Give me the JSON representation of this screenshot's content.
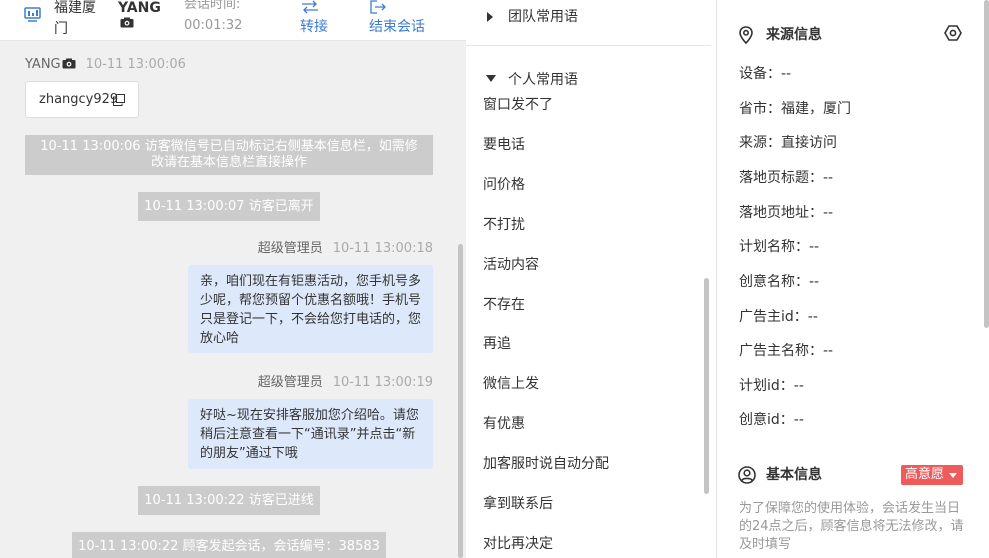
{
  "chat": {
    "header": {
      "location": "福建厦门",
      "visitor_name": "YANG",
      "time_label": "会话时间:",
      "time_value": "00:01:32",
      "transfer_label": "转接",
      "end_label": "结束会话"
    },
    "visitor_message": {
      "sender": "YANG",
      "timestamp": "10-11 13:00:06",
      "text": "zhangcy929"
    },
    "system_messages": [
      "10-11 13:00:06 访客微信号已自动标记右侧基本信息栏，如需修改请在基本信息栏直接操作",
      "10-11 13:00:07 访客已离开",
      "10-11 13:00:22 访客已进线",
      "10-11 13:00:22 顾客发起会话，会话编号：38583"
    ],
    "agent_messages": [
      {
        "sender": "超级管理员",
        "timestamp": "10-11 13:00:18",
        "text": "亲，咱们现在有钜惠活动，您手机号多少呢，帮您预留个优惠名额哦！手机号只是登记一下，不会给您打电话的，您放心哈"
      },
      {
        "sender": "超级管理员",
        "timestamp": "10-11 13:00:19",
        "text": "好哒~现在安排客服加您介绍哈。请您稍后注意查看一下“通讯录”并点击“新的朋友”通过下哦"
      }
    ]
  },
  "phrases": {
    "team_group": "团队常用语",
    "personal_group": "个人常用语",
    "items": [
      "窗口发不了",
      "要电话",
      "问价格",
      "不打扰",
      "活动内容",
      "不存在",
      "再追",
      "微信上发",
      "有优惠",
      "加客服时说自动分配",
      "拿到联系后",
      "对比再决定"
    ]
  },
  "info": {
    "source_title": "来源信息",
    "rows": [
      {
        "label": "设备：",
        "value": "--"
      },
      {
        "label": "省市：",
        "value": "福建，厦门"
      },
      {
        "label": "来源：",
        "value": "直接访问"
      },
      {
        "label": "落地页标题：",
        "value": "--"
      },
      {
        "label": "落地页地址：",
        "value": "--"
      },
      {
        "label": "计划名称：",
        "value": "--"
      },
      {
        "label": "创意名称：",
        "value": "--"
      },
      {
        "label": "广告主id：",
        "value": "--"
      },
      {
        "label": "广告主名称：",
        "value": "--"
      },
      {
        "label": "计划id：",
        "value": "--"
      },
      {
        "label": "创意id：",
        "value": "--"
      }
    ],
    "basic_title": "基本信息",
    "intent": "高意愿",
    "note": "为了保障您的使用体验，会话发生当日的24点之后，顾客信息将无法修改，请及时填写"
  },
  "colors": {
    "accent": "#3d7bd6",
    "agent_bubble": "#dde9fb",
    "system_bubble": "#cccccc",
    "intent_badge": "#ee5b5b"
  },
  "icons": {
    "header": "monitor-icon",
    "camera": "camera-icon",
    "transfer": "transfer-icon",
    "end": "exit-icon",
    "copy": "copy-icon",
    "location": "location-pin-icon",
    "settings": "settings-icon",
    "user": "user-circle-icon"
  }
}
